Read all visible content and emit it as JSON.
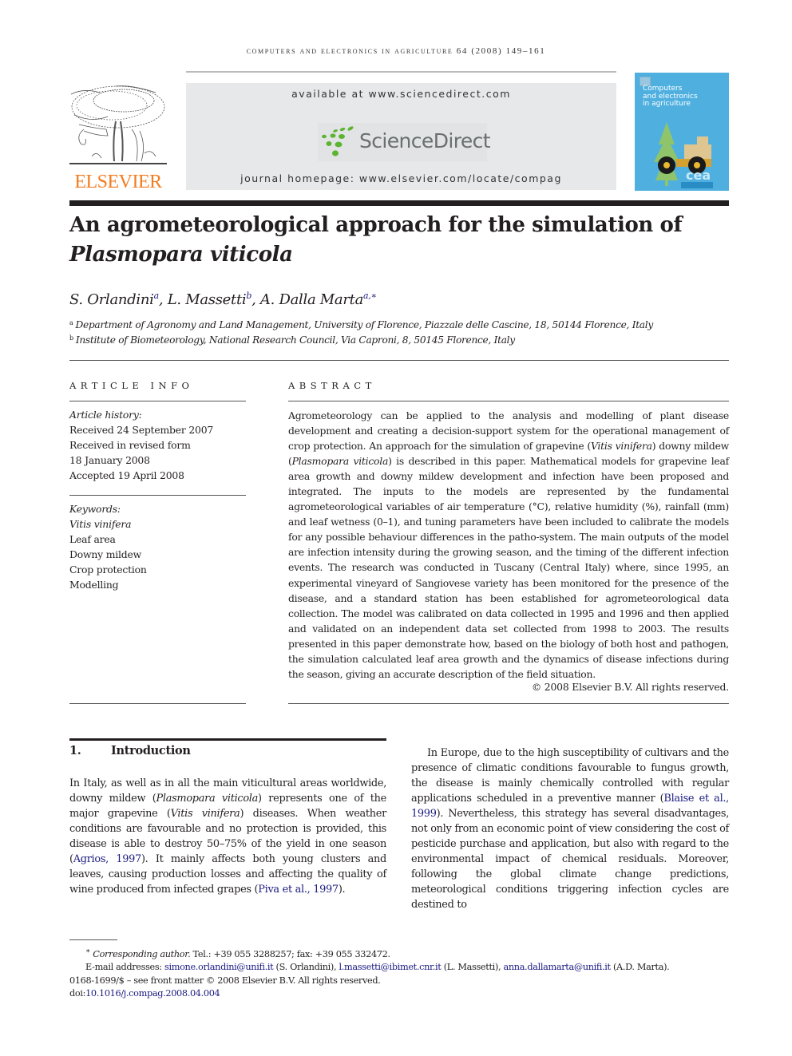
{
  "running_head": "Computers and Electronics in Agriculture 64 (2008) 149–161",
  "publisher": {
    "logo_word": "ELSEVIER",
    "brand_color": "#f47c20"
  },
  "sciencedirect": {
    "available_text": "available at www.sciencedirect.com",
    "logo_text": "ScienceDirect",
    "homepage_text": "journal homepage: www.elsevier.com/locate/compag",
    "logo_green": "#5cb531"
  },
  "cover": {
    "title_lines": [
      "Computers",
      "and electronics",
      "in agriculture"
    ],
    "badge": "cea",
    "color": "#4fb0e0"
  },
  "article": {
    "title_line1": "An agrometeorological approach for the simulation of",
    "title_line2": "Plasmopara viticola",
    "authors": [
      {
        "name": "S. Orlandini",
        "sup": "a"
      },
      {
        "name": "L. Massetti",
        "sup": "b"
      },
      {
        "name": "A. Dalla Marta",
        "sup": "a,∗"
      }
    ],
    "affiliations": [
      {
        "mark": "a",
        "text": "Department of Agronomy and Land Management, University of Florence, Piazzale delle Cascine, 18, 50144 Florence, Italy"
      },
      {
        "mark": "b",
        "text": "Institute of Biometeorology, National Research Council, Via Caproni, 8, 50145 Florence, Italy"
      }
    ]
  },
  "article_info": {
    "heading": "ARTICLE INFO",
    "history_label": "Article history:",
    "history": [
      "Received 24 September 2007",
      "Received in revised form",
      "18 January 2008",
      "Accepted 19 April 2008"
    ],
    "keywords_label": "Keywords:",
    "keywords": [
      "Vitis vinifera",
      "Leaf area",
      "Downy mildew",
      "Crop protection",
      "Modelling"
    ]
  },
  "abstract": {
    "heading": "ABSTRACT",
    "segments": [
      {
        "t": "Agrometeorology can be applied to the analysis and modelling of plant disease development and creating a decision-support system for the operational management of crop protection. An approach for the simulation of grapevine ("
      },
      {
        "t": "Vitis vinifera",
        "i": true
      },
      {
        "t": ") downy mildew ("
      },
      {
        "t": "Plasmopara viticola",
        "i": true
      },
      {
        "t": ") is described in this paper. Mathematical models for grapevine leaf area growth and downy mildew development and infection have been proposed and integrated. The inputs to the models are represented by the fundamental agrometeorological variables of air temperature (°C), relative humidity (%), rainfall (mm) and leaf wetness (0–1), and tuning parameters have been included to calibrate the models for any possible behaviour differences in the patho-system. The main outputs of the model are infection intensity during the growing season, and the timing of the different infection events. The research was conducted in Tuscany (Central Italy) where, since 1995, an experimental vineyard of Sangiovese variety has been monitored for the presence of the disease, and a standard station has been established for agrometeorological data collection. The model was calibrated on data collected in 1995 and 1996 and then applied and validated on an independent data set collected from 1998 to 2003. The results presented in this paper demonstrate how, based on the biology of both host and pathogen, the simulation calculated leaf area growth and the dynamics of disease infections during the season, giving an accurate description of the field situation."
      }
    ],
    "copyright": "© 2008 Elsevier B.V. All rights reserved."
  },
  "introduction": {
    "number": "1.",
    "heading": "Introduction",
    "para1": [
      {
        "t": "In Italy, as well as in all the main viticultural areas worldwide, downy mildew ("
      },
      {
        "t": "Plasmopara viticola",
        "i": true
      },
      {
        "t": ") represents one of the major grapevine ("
      },
      {
        "t": "Vitis vinifera",
        "i": true
      },
      {
        "t": ") diseases. When weather conditions are favourable and no protection is provided, this disease is able to destroy 50–75% of the yield in one season ("
      },
      {
        "t": "Agrios, 1997",
        "c": true
      },
      {
        "t": "). It mainly affects both young clusters and leaves, causing production losses and affecting the quality of wine produced from infected grapes ("
      },
      {
        "t": "Piva et al., 1997",
        "c": true
      },
      {
        "t": ")."
      }
    ],
    "para2": [
      {
        "t": "In Europe, due to the high susceptibility of cultivars and the presence of climatic conditions favourable to fungus growth, the disease is mainly chemically controlled with regular applications scheduled in a preventive manner ("
      },
      {
        "t": "Blaise et al., 1999",
        "c": true
      },
      {
        "t": "). Nevertheless, this strategy has several disadvantages, not only from an economic point of view considering the cost of pesticide purchase and application, but also with regard to the environmental impact of chemical residuals. Moreover, following the global climate change predictions, meteorological conditions triggering infection cycles are destined to"
      }
    ]
  },
  "footnotes": {
    "corresponding_mark": "∗",
    "corresponding_label": "Corresponding author.",
    "corresponding_contact": " Tel.: +39 055 3288257; fax: +39 055 332472.",
    "email_label": "E-mail addresses: ",
    "emails": [
      {
        "address": "simone.orlandini@unifi.it",
        "who": " (S. Orlandini), "
      },
      {
        "address": "l.massetti@ibimet.cnr.it",
        "who": " (L. Massetti), "
      },
      {
        "address": "anna.dallamarta@unifi.it",
        "who": " (A.D. Marta)."
      }
    ],
    "front_matter": "0168-1699/$ – see front matter © 2008 Elsevier B.V. All rights reserved.",
    "doi_label": "doi:",
    "doi": "10.1016/j.compag.2008.04.004"
  }
}
